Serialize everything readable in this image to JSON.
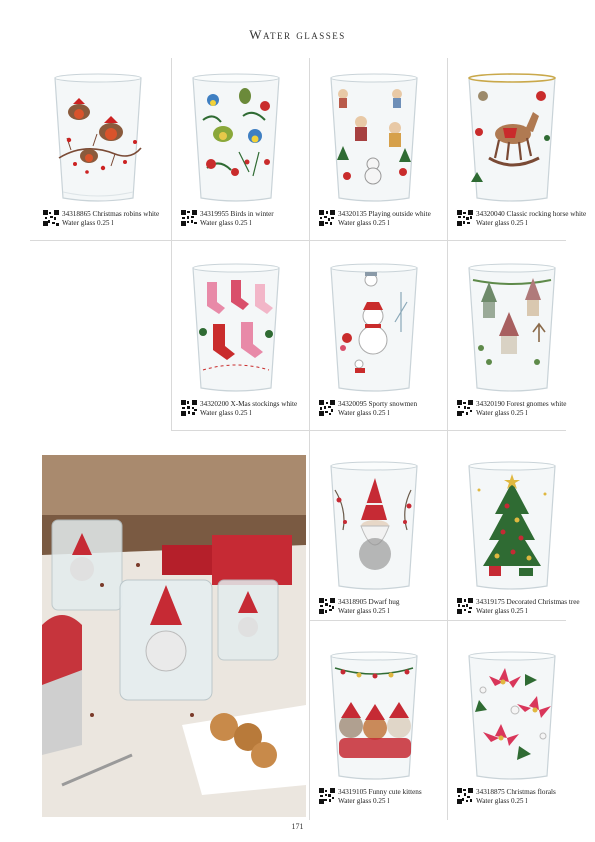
{
  "page": {
    "title": "Water glasses",
    "page_number": "171"
  },
  "products": [
    {
      "code": "34318865",
      "name": "Christmas robins white",
      "desc": "Water glass 0.25 l",
      "motif": "robins"
    },
    {
      "code": "34319955",
      "name": "Birds in winter",
      "desc": "Water glass 0.25 l",
      "motif": "birds"
    },
    {
      "code": "34320135",
      "name": "Playing outside white",
      "desc": "Water glass 0.25 l",
      "motif": "children"
    },
    {
      "code": "34320040",
      "name": "Classic rocking horse white",
      "desc": "Water glass 0.25 l",
      "motif": "rocking-horse"
    },
    {
      "code": "34320200",
      "name": "X-Mas stockings white",
      "desc": "Water glass 0.25 l",
      "motif": "stockings"
    },
    {
      "code": "34320095",
      "name": "Sporty snowmen",
      "desc": "Water glass 0.25 l",
      "motif": "snowmen"
    },
    {
      "code": "34320190",
      "name": "Forest gnomes white",
      "desc": "Water glass 0.25 l",
      "motif": "gnomes"
    },
    {
      "code": "34318905",
      "name": "Dwarf hug",
      "desc": "Water glass 0.25 l",
      "motif": "dwarf"
    },
    {
      "code": "34319175",
      "name": "Decorated Christmas tree",
      "desc": "Water glass 0.25 l",
      "motif": "tree"
    },
    {
      "code": "34319105",
      "name": "Funny cute kittens",
      "desc": "Water glass 0.25 l",
      "motif": "kittens"
    },
    {
      "code": "34318875",
      "name": "Christmas florals",
      "desc": "Water glass 0.25 l",
      "motif": "poinsettia"
    }
  ]
}
